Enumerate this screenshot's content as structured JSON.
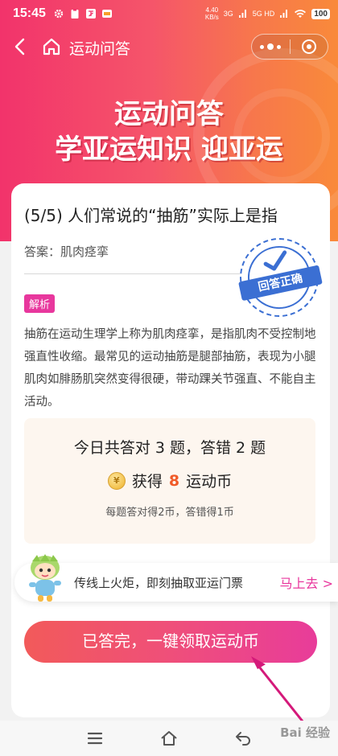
{
  "status_bar": {
    "time": "15:45",
    "net_speed_value": "4.40",
    "net_speed_unit": "KB/s",
    "signal_1": "3G",
    "signal_2": "5G HD",
    "battery": "100"
  },
  "nav": {
    "title": "运动问答"
  },
  "banner": {
    "line1": "运动问答",
    "line2": "学亚运知识 迎亚运"
  },
  "question": {
    "text": "(5/5) 人们常说的“抽筋”实际上是指",
    "answer": "答案：肌肉痉挛",
    "stamp_text": "回答正确",
    "tag": "解析",
    "explanation": "抽筋在运动生理学上称为肌肉痉挛，是指肌肉不受控制地强直性收缩。最常见的运动抽筋是腿部抽筋，表现为小腿肌肉如腓肠肌突然变得很硬，带动踝关节强直、不能自主活动。"
  },
  "stats": {
    "summary": "今日共答对 3 题，答错 2 题",
    "earned_prefix": "获得",
    "earned_value": "8",
    "earned_suffix": "运动币",
    "rule": "每题答对得2币，答错得1币"
  },
  "torch": {
    "text": "传线上火炬，即刻抽取亚运门票",
    "go": "马上去 >"
  },
  "main_button": {
    "label": "已答完，一键领取运动币"
  },
  "watermark": "Bai 经验",
  "colors": {
    "accent_pink": "#e8379d",
    "header_gradient_start": "#f2336b",
    "header_gradient_end": "#f98a3a",
    "stamp_blue": "#3b6fd3",
    "earned_highlight": "#f05a28"
  }
}
